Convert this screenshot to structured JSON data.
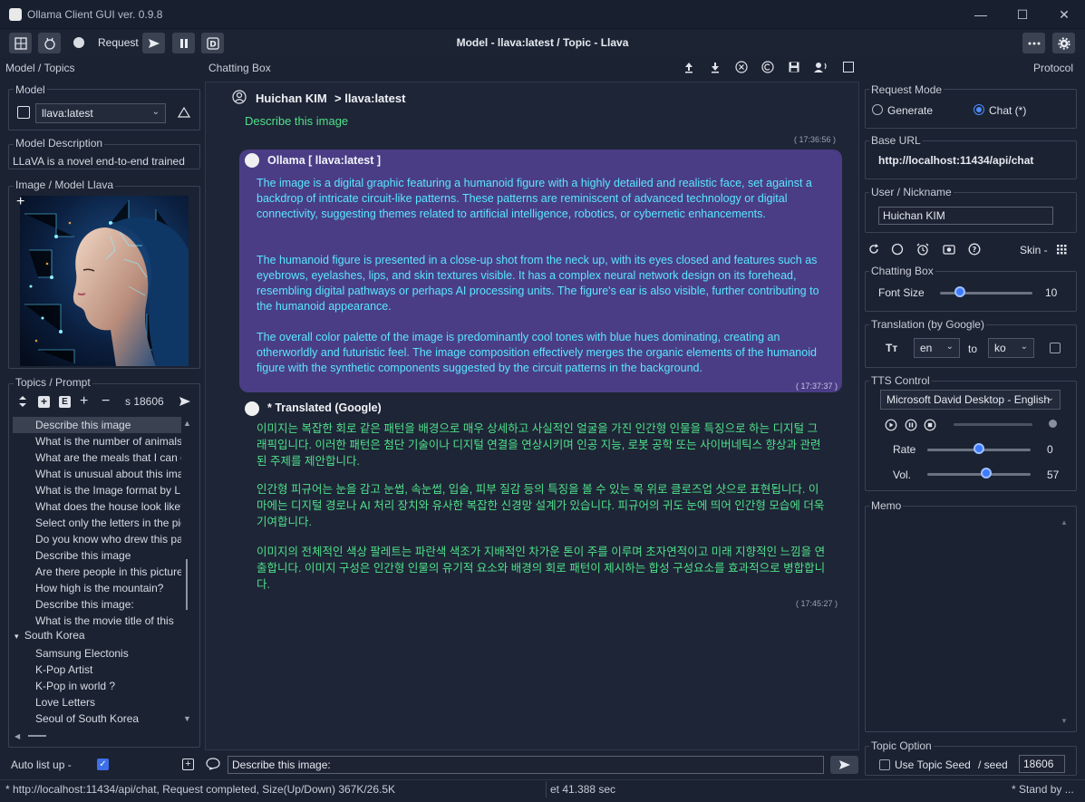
{
  "window": {
    "title": "Ollama Client GUI  ver. 0.9.8",
    "minimize": "—",
    "maximize": "☐",
    "close": "✕"
  },
  "toolbar": {
    "request_label": "Request",
    "center_title": "Model - llava:latest / Topic - Llava"
  },
  "panels": {
    "left_header": "Model / Topics",
    "chat_header": "Chatting Box",
    "right_header": "Protocol"
  },
  "model": {
    "group": "Model",
    "selected": "llava:latest",
    "desc_group": "Model Description",
    "description": "LLaVA is a novel end-to-end trained",
    "image_group": "Image / Model Llava",
    "plus": "+"
  },
  "topics": {
    "group": "Topics / Prompt",
    "seed_field": "s 18606",
    "items": [
      "Describe this image",
      "What is the number of animals",
      "What are the meals that I can c",
      "What is unusual about this ima",
      "What is the Image format by L",
      "What does the house look like?",
      "Select only the letters in the pic",
      "Do you know who drew this pa",
      "Describe this image",
      "Are there people in this picture",
      "How high is the mountain?",
      "Describe this image:",
      "What is the movie title of  this"
    ],
    "folder": "South Korea",
    "folder_items": [
      "Samsung Electonis",
      "K-Pop Artist",
      "K-Pop in world ?",
      "Love Letters",
      "Seoul of South Korea"
    ]
  },
  "chat": {
    "user_name": "Huichan KIM",
    "arrow_model": ">  llava:latest",
    "user_prompt": "Describe this image",
    "ts1": "( 17:36:56 )",
    "ollama_header": "Ollama [ llava:latest ]",
    "response_paragraphs": [
      "The image is a digital graphic featuring a humanoid figure with a highly detailed and realistic face, set against a backdrop of intricate circuit-like patterns. These patterns are reminiscent of advanced technology or digital connectivity, suggesting themes related to artificial intelligence, robotics, or cybernetic enhancements.",
      "The humanoid figure is presented in a close-up shot from the neck up, with its eyes closed and features such as eyebrows, eyelashes, lips, and skin textures visible. It has a complex neural network design on its forehead, resembling digital pathways or perhaps AI processing units. The figure's ear is also visible, further contributing to the humanoid appearance.",
      "The overall color palette of the image is predominantly cool tones with blue hues dominating, creating an otherworldly and futuristic feel. The image composition effectively merges the organic elements of the humanoid figure with the synthetic components suggested by the circuit patterns in the background."
    ],
    "ts2": "( 17:37:37 )",
    "translated_header": "* Translated (Google)",
    "translated_paragraphs": [
      "이미지는 복잡한 회로 같은 패턴을 배경으로 매우 상세하고 사실적인 얼굴을 가진 인간형 인물을 특징으로 하는 디지털 그래픽입니다. 이러한 패턴은 첨단 기술이나 디지털 연결을 연상시키며 인공 지능, 로봇 공학 또는 사이버네틱스 향상과 관련된 주제를 제안합니다.",
      "인간형 피규어는 눈을 감고 눈썹, 속눈썹, 입술, 피부 질감 등의 특징을 볼 수 있는 목 위로 클로즈업 샷으로 표현됩니다. 이마에는 디지털 경로나 AI 처리 장치와 유사한 복잡한 신경망 설계가 있습니다. 피규어의 귀도 눈에 띄어 인간형 모습에 더욱 기여합니다.",
      "이미지의 전체적인 색상 팔레트는 파란색 색조가 지배적인 차가운 톤이 주를 이루며 초자연적이고 미래 지향적인 느낌을 연출합니다. 이미지 구성은 인간형 인물의 유기적 요소와 배경의 회로 패턴이 제시하는 합성 구성요소를 효과적으로 병합합니다."
    ],
    "ts3": "( 17:45:27 )",
    "input_value": "Describe this image:",
    "auto_list_up": "Auto list up  -"
  },
  "right": {
    "request_mode": "Request Mode",
    "generate": "Generate",
    "chat": "Chat (*)",
    "base_url_group": "Base URL",
    "base_url": "http://localhost:11434/api/chat",
    "user_group": "User / Nickname",
    "user_value": "Huichan KIM",
    "skin": "Skin -",
    "chatting_box": "Chatting Box",
    "font_size_label": "Font Size",
    "font_size": "10",
    "font_size_level": 0.22,
    "translation_group": "Translation (by Google)",
    "tt_icon": "Tт",
    "from_lang": "en",
    "to_label": "to",
    "to_lang": "ko",
    "tts_group": "TTS Control",
    "voice": "Microsoft David Desktop - English",
    "rate_label": "Rate",
    "rate_value": "0",
    "rate_level": 0.5,
    "vol_label": "Vol.",
    "vol_value": "57",
    "vol_level": 0.57,
    "memo_group": "Memo",
    "topic_option": "Topic Option",
    "use_topic_seed": "Use Topic Seed",
    "seed_label": "/ seed",
    "seed_value": "18606"
  },
  "status": {
    "left": "* http://localhost:11434/api/chat, Request completed, Size(Up/Down) 367K/26.5K",
    "middle": "et 41.388 sec",
    "right": "* Stand by ..."
  },
  "colors": {
    "background": "#1b2232",
    "bubble": "#4a3d86",
    "response_text": "#5ae6ff",
    "user_text": "#4fe08a",
    "accent": "#4e8cff"
  }
}
